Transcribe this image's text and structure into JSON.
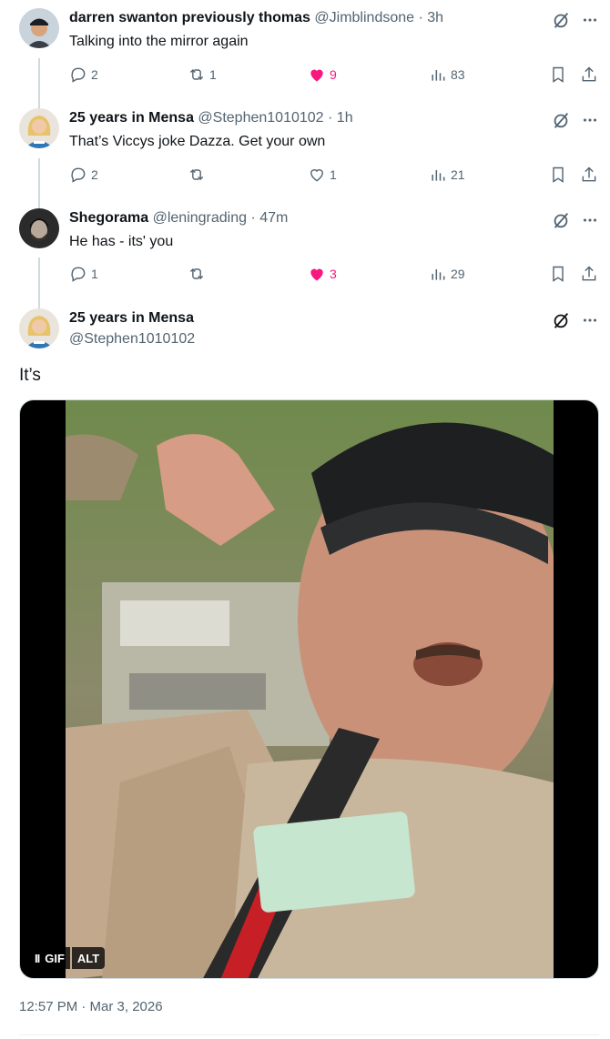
{
  "replies": [
    {
      "name": "darren swanton previously thomas",
      "handle": "@Jimblindsone",
      "time": "3h",
      "text": "Talking into the mirror again",
      "replies": "2",
      "reposts": "1",
      "likes": "9",
      "liked": true,
      "views": "83",
      "avatar_icon": "man-cap-avatar"
    },
    {
      "name": "25 years in Mensa",
      "handle": "@Stephen1010102",
      "time": "1h",
      "text": "That’s Viccys joke Dazza. Get your own",
      "replies": "2",
      "reposts": "",
      "likes": "1",
      "liked": false,
      "views": "21",
      "avatar_icon": "woman-blonde-avatar"
    },
    {
      "name": "Shegorama",
      "handle": "@leningrading",
      "time": "47m",
      "text": "He has - its' you",
      "replies": "1",
      "reposts": "",
      "likes": "3",
      "liked": true,
      "views": "29",
      "avatar_icon": "man-dark-avatar"
    }
  ],
  "separator": "·",
  "main_tweet": {
    "name": "25 years in Mensa",
    "handle": "@Stephen1010102",
    "text": "It’s",
    "media_badges": {
      "pause": "II",
      "gif": "GIF",
      "alt": "ALT"
    },
    "timestamp": "12:57 PM · Mar 3, 2026"
  },
  "colors": {
    "like_pink": "#f91880",
    "muted": "#536471",
    "text": "#0f1419",
    "thread": "#cfd9de"
  }
}
